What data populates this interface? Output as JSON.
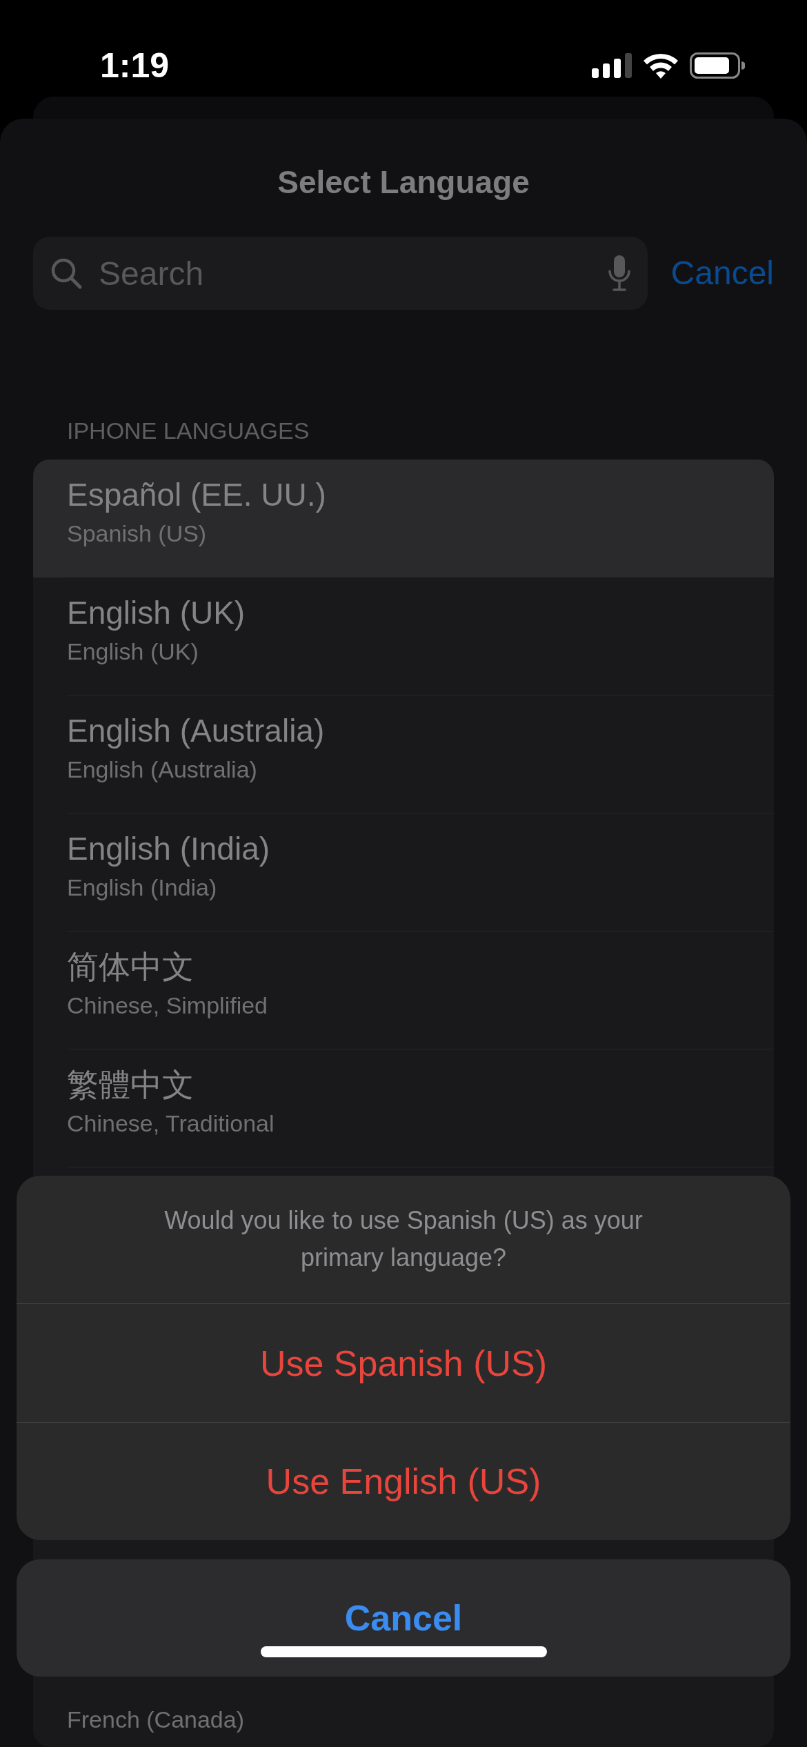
{
  "status_bar": {
    "time": "1:19"
  },
  "sheet": {
    "title": "Select Language",
    "search": {
      "placeholder": "Search"
    },
    "cancel": "Cancel"
  },
  "section": {
    "header": "IPHONE LANGUAGES",
    "items": [
      {
        "title": "Español (EE. UU.)",
        "subtitle": "Spanish (US)",
        "selected": true
      },
      {
        "title": "English (UK)",
        "subtitle": "English (UK)",
        "selected": false
      },
      {
        "title": "English (Australia)",
        "subtitle": "English (Australia)",
        "selected": false
      },
      {
        "title": "English (India)",
        "subtitle": "English (India)",
        "selected": false
      },
      {
        "title": "简体中文",
        "subtitle": "Chinese, Simplified",
        "selected": false
      },
      {
        "title": "繁體中文",
        "subtitle": "Chinese, Traditional",
        "selected": false
      },
      {
        "subtitle": "French (Canada)",
        "selected": false
      }
    ]
  },
  "action_sheet": {
    "message": "Would you like to use Spanish (US) as your primary language?",
    "actions": [
      {
        "label": "Use Spanish (US)",
        "kind": "destructive"
      },
      {
        "label": "Use English (US)",
        "kind": "destructive"
      }
    ],
    "cancel": "Cancel"
  }
}
